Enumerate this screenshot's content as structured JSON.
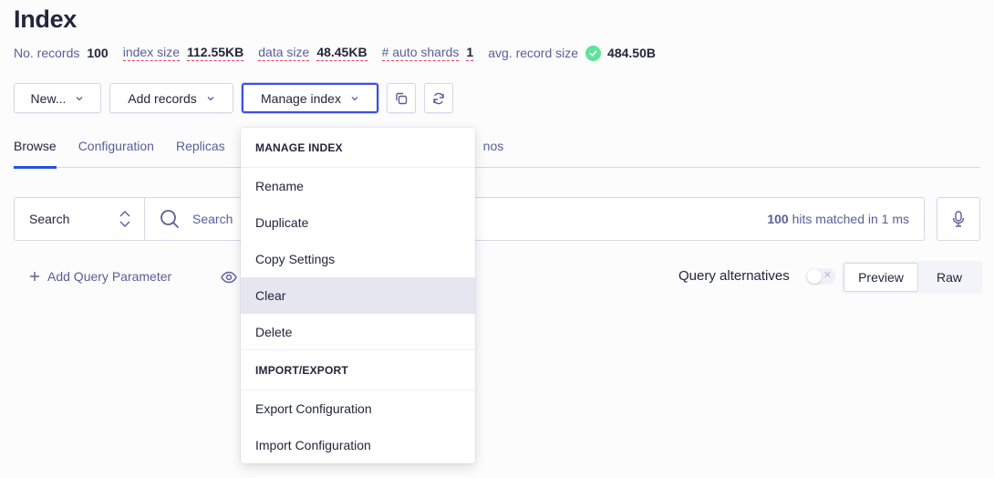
{
  "page": {
    "title": "Index"
  },
  "stats": {
    "records_label": "No. records",
    "records_value": "100",
    "index_size_label": "index size",
    "index_size_value": "112.55KB",
    "data_size_label": "data size",
    "data_size_value": "48.45KB",
    "auto_shards_label": "# auto shards",
    "auto_shards_value": "1",
    "avg_record_label": "avg. record size",
    "avg_record_value": "484.50B",
    "avg_record_status": "ok"
  },
  "toolbar": {
    "new_label": "New...",
    "add_records_label": "Add records",
    "manage_index_label": "Manage index",
    "copy_icon": "copy-icon",
    "refresh_icon": "refresh-icon"
  },
  "tabs": [
    {
      "label": "Browse",
      "active": true
    },
    {
      "label": "Configuration",
      "active": false
    },
    {
      "label": "Replicas",
      "active": false
    },
    {
      "label": "nos",
      "active": false
    }
  ],
  "search": {
    "select_value": "Search",
    "placeholder": "Search",
    "hits_count": "100",
    "hits_text": " hits matched in 1 ms"
  },
  "query": {
    "add_param_label": "Add Query Parameter",
    "alternatives_label": "Query alternatives",
    "alternatives_enabled": false
  },
  "view_toggle": {
    "preview_label": "Preview",
    "raw_label": "Raw",
    "selected": "Preview"
  },
  "manage_menu": {
    "section1_header": "MANAGE INDEX",
    "items1": [
      "Rename",
      "Duplicate",
      "Copy Settings",
      "Clear",
      "Delete"
    ],
    "hovered": "Clear",
    "section2_header": "IMPORT/EXPORT",
    "items2": [
      "Export Configuration",
      "Import Configuration"
    ]
  },
  "colors": {
    "accent": "#2452d8",
    "focus_border": "#3c4fe0",
    "success": "#5ee39b",
    "warning_dash": "#e8405d",
    "muted_text": "#5a5e9a",
    "text": "#23263b"
  }
}
